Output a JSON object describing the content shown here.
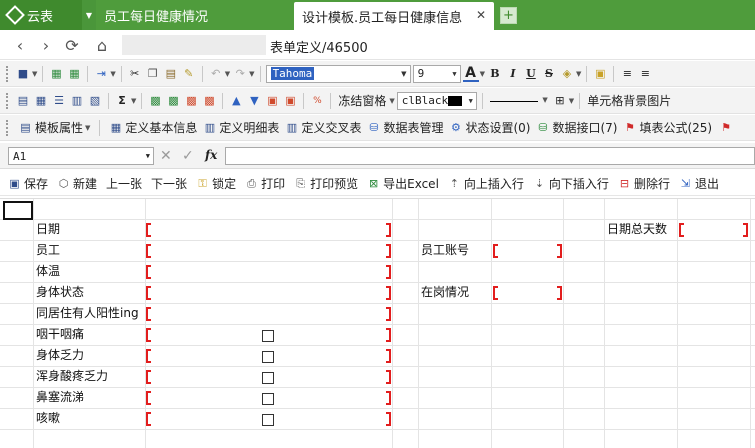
{
  "app": {
    "name": "云表"
  },
  "tabs": [
    {
      "label": "员工每日健康情况",
      "active": false
    },
    {
      "label": "设计模板.员工每日健康信息",
      "active": true
    }
  ],
  "nav": {
    "url_text": "表单定义/46500"
  },
  "toolbar": {
    "font_name": "Tahoma",
    "font_size": "9",
    "bold": "B",
    "italic": "I",
    "underline": "U",
    "strike": "S",
    "freeze_label": "冻结窗格",
    "color_value": "clBlack",
    "cell_bg_label": "单元格背景图片",
    "sum_symbol": "Σ"
  },
  "ribbon3": {
    "items": [
      {
        "label": "模板属性",
        "icon": "template-props-icon",
        "dropdown": true
      },
      {
        "label": "定义基本信息",
        "icon": "basic-info-icon"
      },
      {
        "label": "定义明细表",
        "icon": "detail-table-icon"
      },
      {
        "label": "定义交叉表",
        "icon": "cross-table-icon"
      },
      {
        "label": "数据表管理",
        "icon": "data-table-icon"
      },
      {
        "label": "状态设置(0)",
        "icon": "status-icon"
      },
      {
        "label": "数据接口(7)",
        "icon": "data-interface-icon"
      },
      {
        "label": "填表公式(25)",
        "icon": "formula-flag-icon"
      }
    ]
  },
  "formula_bar": {
    "cell_ref": "A1",
    "fx": "fx",
    "value": ""
  },
  "actions": [
    {
      "label": "保存",
      "icon": "save-icon"
    },
    {
      "label": "新建",
      "icon": "new-icon"
    },
    {
      "label": "上一张",
      "icon": ""
    },
    {
      "label": "下一张",
      "icon": ""
    },
    {
      "label": "锁定",
      "icon": "lock-icon"
    },
    {
      "label": "打印",
      "icon": "print-icon"
    },
    {
      "label": "打印预览",
      "icon": "print-preview-icon"
    },
    {
      "label": "导出Excel",
      "icon": "excel-icon"
    },
    {
      "label": "向上插入行",
      "icon": "insert-up-icon"
    },
    {
      "label": "向下插入行",
      "icon": "insert-down-icon"
    },
    {
      "label": "删除行",
      "icon": "delete-row-icon"
    },
    {
      "label": "退出",
      "icon": "exit-icon"
    }
  ],
  "form": {
    "labels": [
      "日期",
      "员工",
      "体温",
      "身体状态",
      "同居住有人阳性ing",
      "咽干咽痛",
      "身体乏力",
      "浑身酸疼乏力",
      "鼻塞流涕",
      "咳嗽"
    ],
    "employee_account": "员工账号",
    "on_duty": "在岗情况",
    "date_total_days": "日期总天数"
  },
  "colors": {
    "brand_green": "#4f9c3c",
    "marker_red": "#e21d1d"
  }
}
